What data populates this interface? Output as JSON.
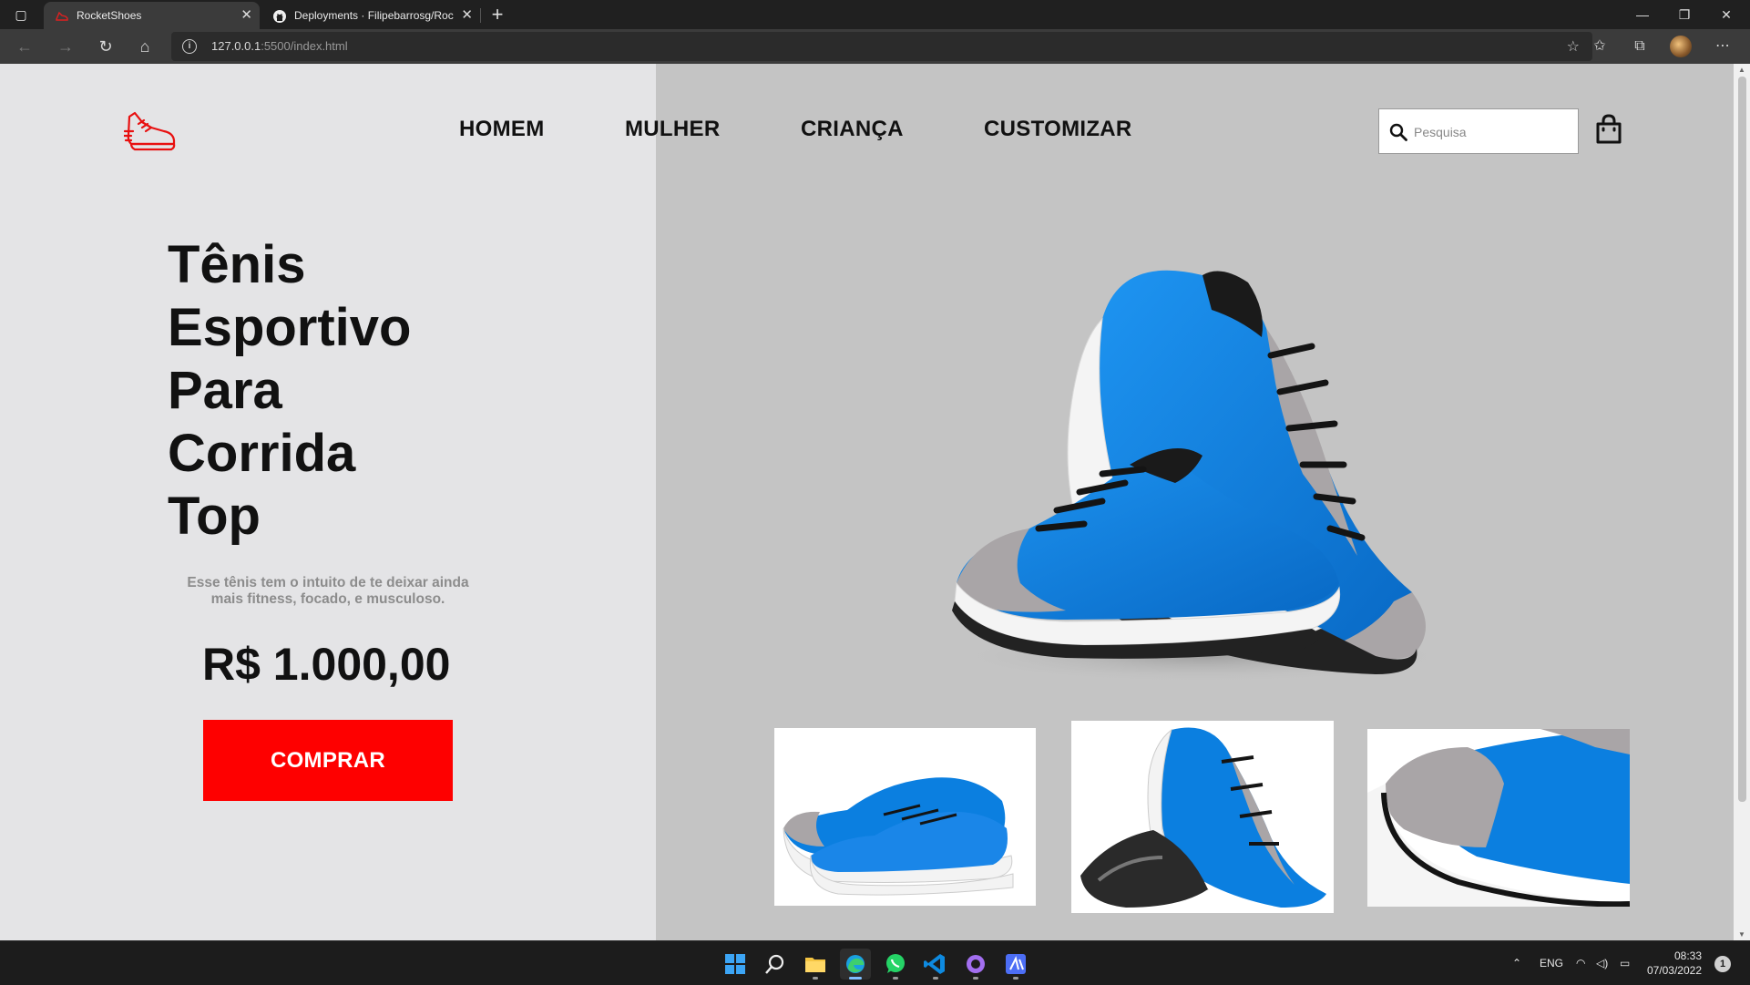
{
  "browser": {
    "tabs": [
      {
        "title": "RocketShoes",
        "active": true
      },
      {
        "title": "Deployments · Filipebarrosg/Roc",
        "active": false
      }
    ],
    "url_host": "127.0.0.1",
    "url_rest": ":5500/index.html"
  },
  "header": {
    "nav": [
      "HOMEM",
      "MULHER",
      "CRIANÇA",
      "CUSTOMIZAR"
    ],
    "search_placeholder": "Pesquisa"
  },
  "hero": {
    "title_lines": [
      "Tênis",
      "Esportivo",
      "Para",
      "Corrida",
      "Top"
    ],
    "description": "Esse tênis tem o intuito de te deixar ainda mais fitness, focado, e musculoso.",
    "price": "R$ 1.000,00",
    "cta": "COMPRAR"
  },
  "colors": {
    "accent": "#FE0000",
    "left_bg": "#E4E4E6",
    "right_bg": "#C4C4C4",
    "shoe_blue": "#0B7FE0",
    "shoe_grey": "#A8A4A6"
  },
  "taskbar": {
    "language": "ENG",
    "time": "08:33",
    "date": "07/03/2022",
    "notifications": "1"
  }
}
